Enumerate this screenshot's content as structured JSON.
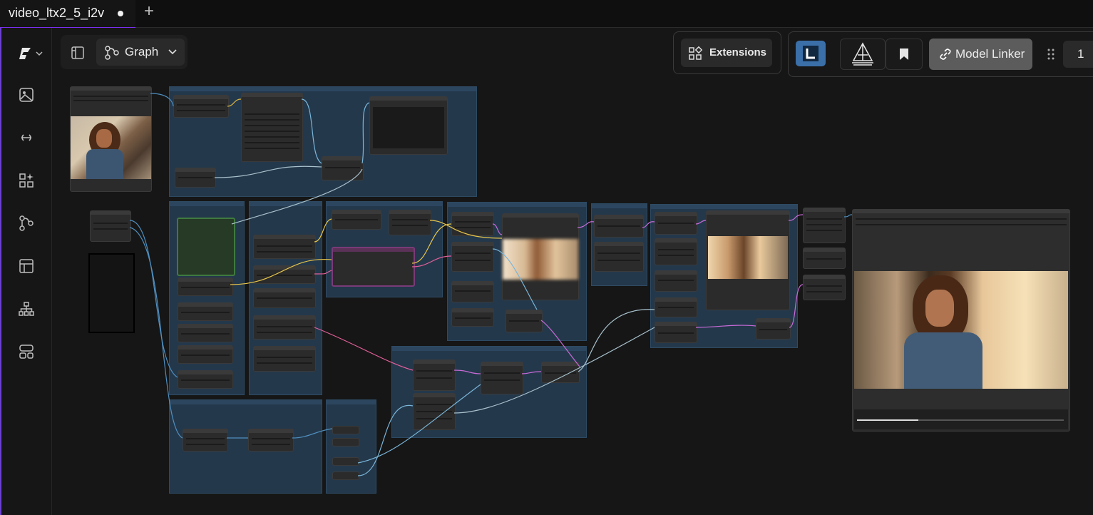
{
  "tab": {
    "title": "video_ltx2_5_i2v"
  },
  "toolbar": {
    "view_label": "Graph",
    "extensions_label": "Extensions",
    "model_linker_label": "Model Linker",
    "counter": "1"
  },
  "colors": {
    "accent": "#7b2ff0",
    "group": "#24384b",
    "node": "#2b2b2b",
    "canvas": "#161616"
  },
  "icons": {
    "rail": [
      "comfy-logo-icon",
      "image-icon",
      "link-icon",
      "sparkle-grid-icon",
      "workflow-icon",
      "template-icon",
      "tree-icon",
      "layout-icon"
    ]
  }
}
